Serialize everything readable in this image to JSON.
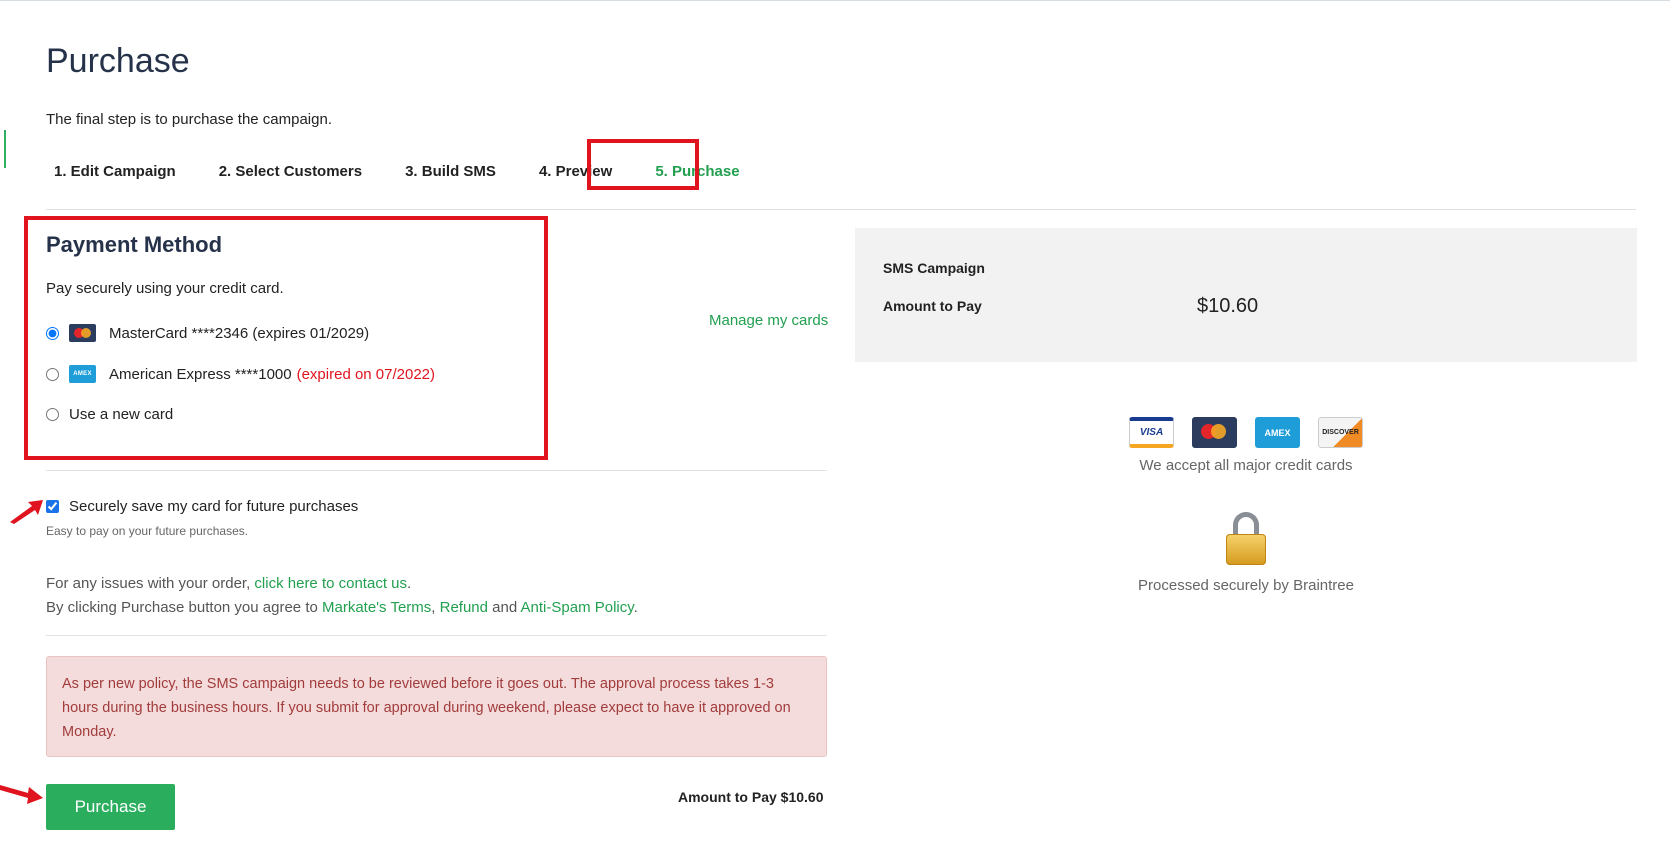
{
  "page": {
    "title": "Purchase",
    "subtitle": "The final step is to purchase the campaign."
  },
  "steps": [
    {
      "label": "1. Edit Campaign",
      "active": false
    },
    {
      "label": "2. Select Customers",
      "active": false
    },
    {
      "label": "3. Build SMS",
      "active": false
    },
    {
      "label": "4. Preview",
      "active": false
    },
    {
      "label": "5. Purchase",
      "active": true
    }
  ],
  "payment": {
    "title": "Payment Method",
    "subtitle": "Pay securely using your credit card.",
    "manage_link": "Manage my cards",
    "options": [
      {
        "label": "MasterCard ****2346 (expires 01/2029)",
        "icon": "mastercard-icon",
        "checked": true,
        "note": ""
      },
      {
        "label": "American Express ****1000",
        "icon": "amex-icon",
        "checked": false,
        "note": "(expired on 07/2022)"
      },
      {
        "label": "Use a new card",
        "icon": "",
        "checked": false,
        "note": ""
      }
    ],
    "amex_icon_text": "AMEX",
    "save_card_label": "Securely save my card for future purchases",
    "save_card_checked": true,
    "save_card_hint": "Easy to pay on your future purchases."
  },
  "legal": {
    "issues_prefix": "For any issues with your order, ",
    "issues_link": "click here to contact us",
    "issues_suffix": ".",
    "agree_prefix": "By clicking Purchase button you agree to ",
    "terms_link": "Markate's Terms",
    "comma": ", ",
    "refund_link": "Refund",
    "and_text": " and ",
    "antispam_link": "Anti-Spam Policy",
    "period": "."
  },
  "alert": {
    "text": "As per new policy, the SMS campaign needs to be reviewed before it goes out. The approval process takes 1-3 hours during the business hours. If you submit for approval during weekend, please expect to have it approved on Monday."
  },
  "purchase_button": "Purchase",
  "bottom_amount": "Amount to Pay $10.60",
  "summary": {
    "campaign_label": "SMS Campaign",
    "amount_label": "Amount to Pay",
    "amount_value": "$10.60"
  },
  "accepted": {
    "logos": [
      "visa-logo",
      "mastercard-logo",
      "amex-logo",
      "discover-logo"
    ],
    "visa_text": "VISA",
    "amex_text": "AMEX",
    "discover_text": "DISCOVER",
    "text": "We accept all major credit cards"
  },
  "secure": {
    "icon": "lock-icon",
    "text": "Processed securely by Braintree"
  },
  "colors": {
    "accent_green": "#22a050",
    "button_green": "#2aae5e",
    "highlight_red": "#e0141e",
    "title_navy": "#25324a",
    "alert_bg": "#f5dcdc"
  }
}
